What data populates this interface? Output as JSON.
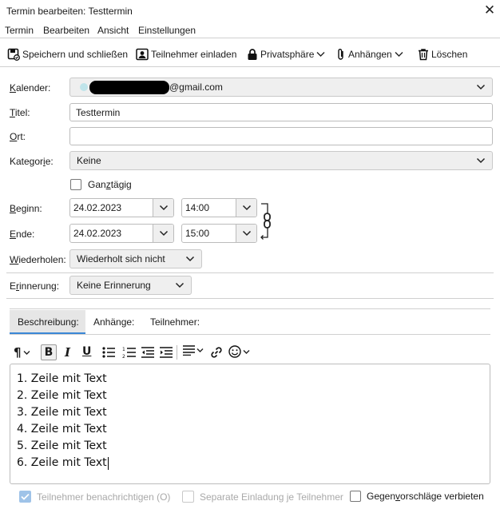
{
  "window": {
    "title": "Termin bearbeiten: Testtermin",
    "close_glyph": "✕"
  },
  "menu": [
    "Termin",
    "Bearbeiten",
    "Ansicht",
    "Einstellungen"
  ],
  "toolbar": {
    "save_close": "Speichern und schließen",
    "invite": "Teilnehmer einladen",
    "privacy": "Privatsphäre",
    "attachments": "Anhängen",
    "delete": "Löschen"
  },
  "form": {
    "calendar_label": "Kalender:",
    "calendar_value": "@gmail.com",
    "title_label": "Titel:",
    "title_value": "Testtermin",
    "location_label": "Ort:",
    "location_value": "",
    "category_label": "Kategorie:",
    "category_value": "Keine",
    "allday_label": "Ganztägig",
    "start_label": "Beginn:",
    "start_date": "24.02.2023",
    "start_time": "14:00",
    "end_label": "Ende:",
    "end_date": "24.02.2023",
    "end_time": "15:00",
    "repeat_label": "Wiederholen:",
    "repeat_value": "Wiederholt sich nicht",
    "reminder_label": "Erinnerung:",
    "reminder_value": "Keine Erinnerung"
  },
  "tabs": [
    "Beschreibung:",
    "Anhänge:",
    "Teilnehmer:"
  ],
  "description_lines": [
    "1. Zeile mit Text",
    "2. Zeile mit Text",
    "3. Zeile mit Text",
    "4. Zeile mit Text",
    "5. Zeile mit Text",
    "6. Zeile mit Text"
  ],
  "footer": {
    "notify": "Teilnehmer benachrichtigen (O)",
    "separate": "Separate Einladung je Teilnehmer",
    "no_counter": "Gegenvorschläge verbieten"
  },
  "icons": {
    "chevron": "chevron-down-icon",
    "link": "chain-link-icon",
    "emoji": "smiley-icon"
  },
  "colors": {
    "accent": "#3b87d6",
    "tab_selected_bg": "#e6e6e6",
    "field_border": "#bcbcbc"
  }
}
